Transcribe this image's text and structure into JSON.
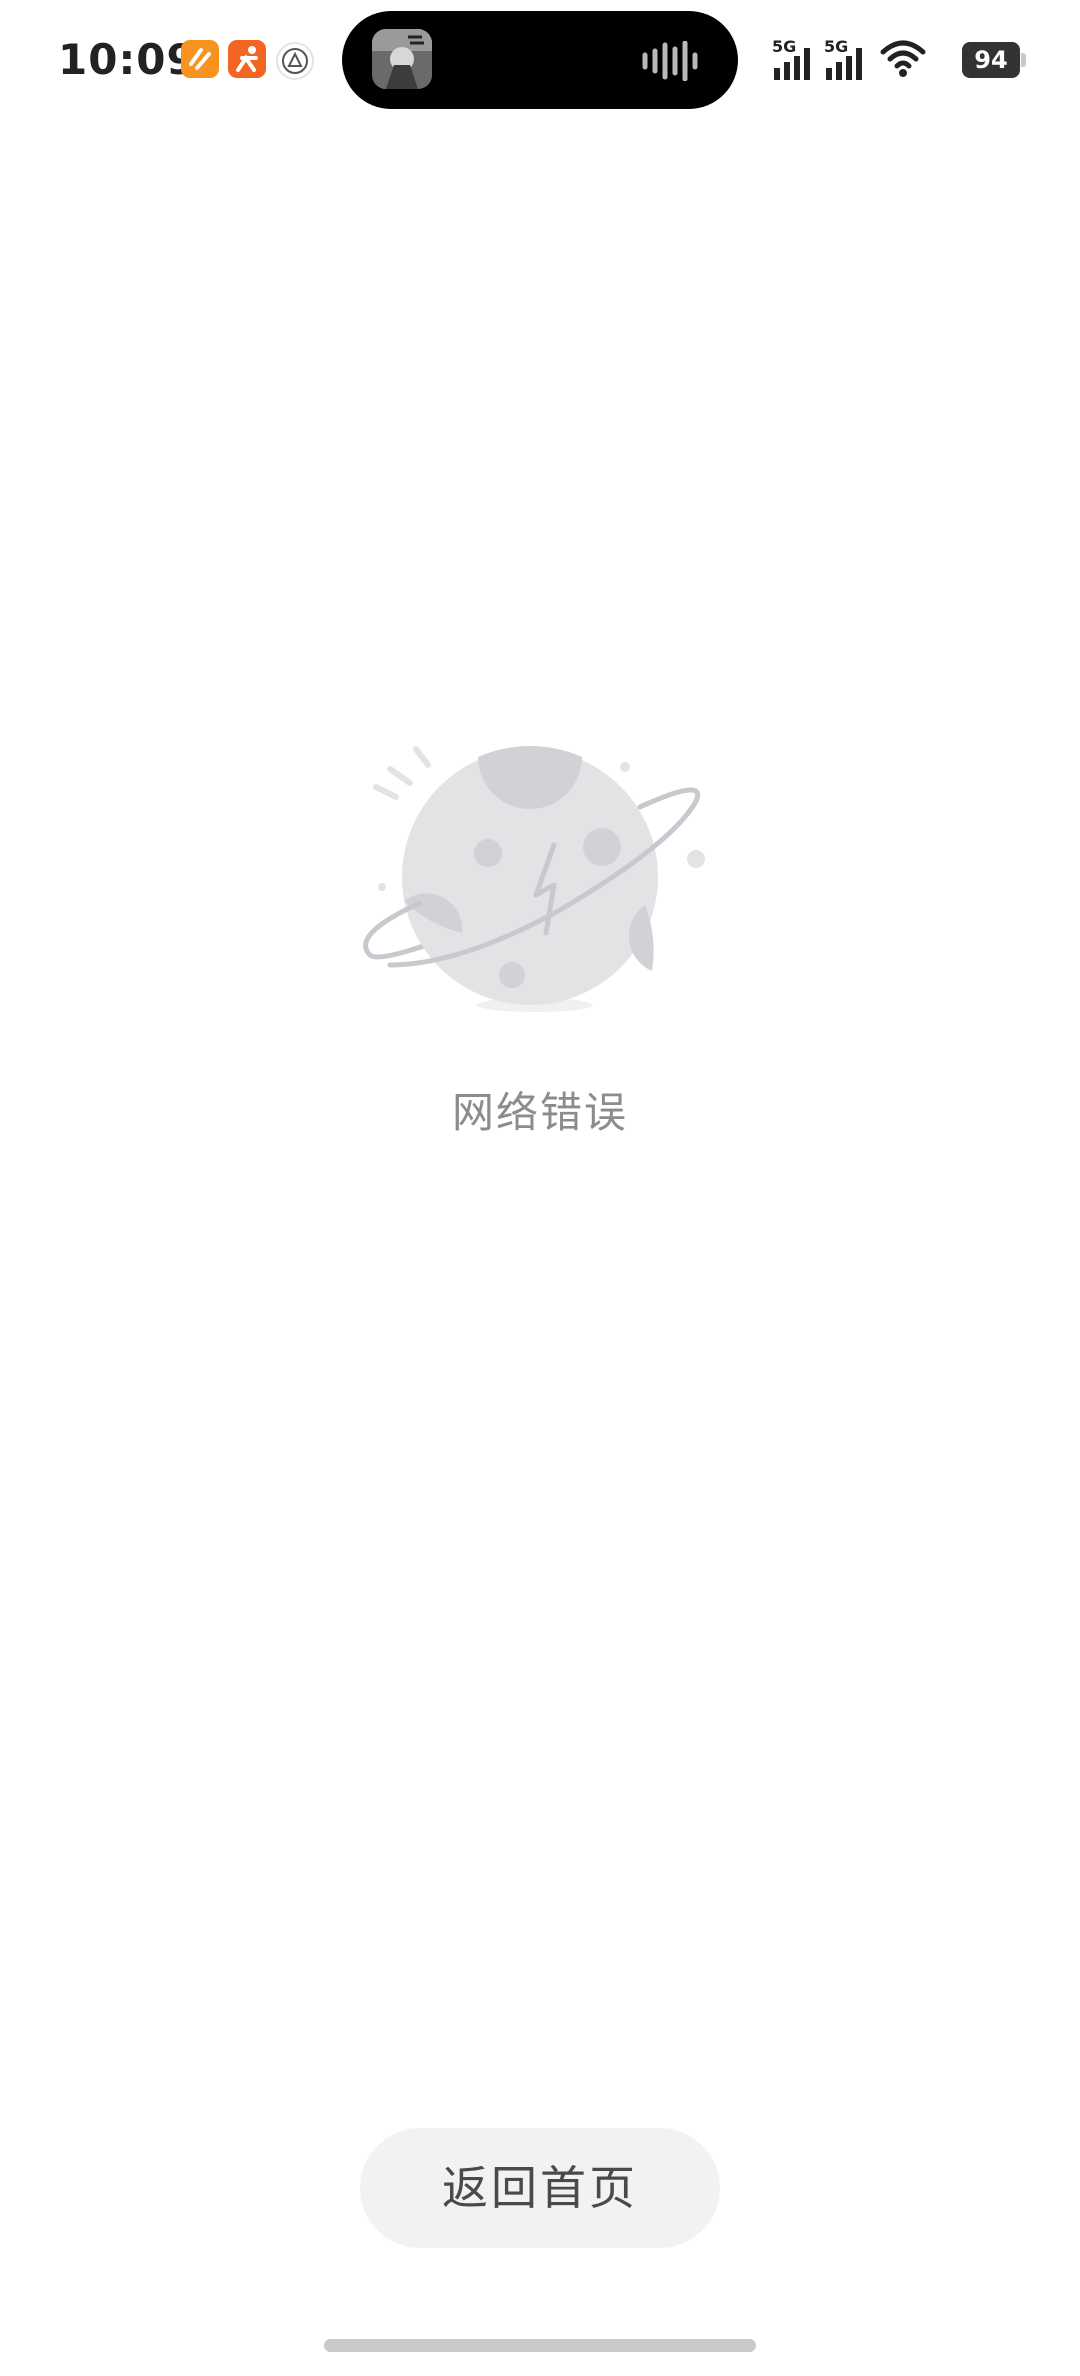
{
  "status_bar": {
    "time": "10:09",
    "network_1": "5G",
    "network_2": "5G",
    "battery": "94",
    "notification_icons": [
      "orange-app-icon",
      "orange-runner-app-icon",
      "circle-logo-app-icon"
    ],
    "signal_icon": "cellular-signal-icon",
    "wifi_icon": "wifi-icon"
  },
  "dynamic_island": {
    "thumbnail_icon": "media-thumbnail-icon",
    "activity_icon": "audio-waveform-icon"
  },
  "error": {
    "illustration": "planet-error-illustration",
    "message": "网络错误"
  },
  "actions": {
    "home_label": "返回首页"
  },
  "colors": {
    "background": "#ffffff",
    "message_text": "#8c8c8c",
    "button_background": "#f2f2f2",
    "button_text": "#4a4a4a",
    "planet_fill": "#e3e3e6",
    "planet_crater": "#d2d2d6",
    "orbit": "#c8c9ce"
  }
}
